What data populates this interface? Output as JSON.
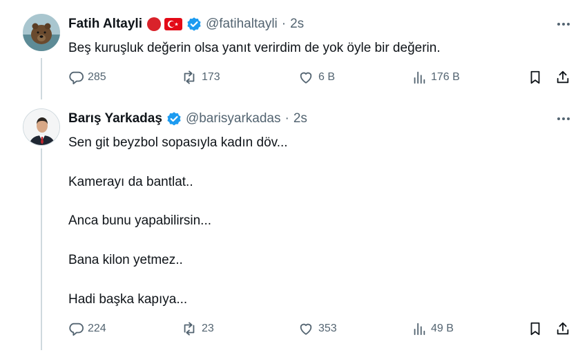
{
  "tweets": [
    {
      "name": "Fatih Altayli",
      "handle": "@fatihaltayli",
      "time": "2s",
      "text_lines": [
        "Beş kuruşluk değerin olsa yanıt verirdim de yok öyle bir değerin."
      ],
      "stats": {
        "replies": "285",
        "reposts": "173",
        "likes": "6 B",
        "views": "176 B"
      },
      "badges": [
        "red-circle",
        "turkey-flag",
        "verified"
      ]
    },
    {
      "name": "Barış Yarkadaş",
      "handle": "@barisyarkadas",
      "time": "2s",
      "text_lines": [
        "Sen git beyzbol sopasıyla kadın döv...",
        "Kamerayı da bantlat..",
        "Anca bunu yapabilirsin...",
        "Bana kilon yetmez..",
        "Hadi başka kapıya..."
      ],
      "stats": {
        "replies": "224",
        "reposts": "23",
        "likes": "353",
        "views": "49 B"
      },
      "badges": [
        "verified"
      ]
    }
  ],
  "colors": {
    "verified": "#1d9bf0",
    "muted": "#536471",
    "thread_line": "#cfd9de",
    "flag_red": "#e30a17"
  },
  "icons": [
    "reply-icon",
    "repost-icon",
    "like-icon",
    "views-icon",
    "bookmark-icon",
    "share-icon",
    "more-icon"
  ]
}
